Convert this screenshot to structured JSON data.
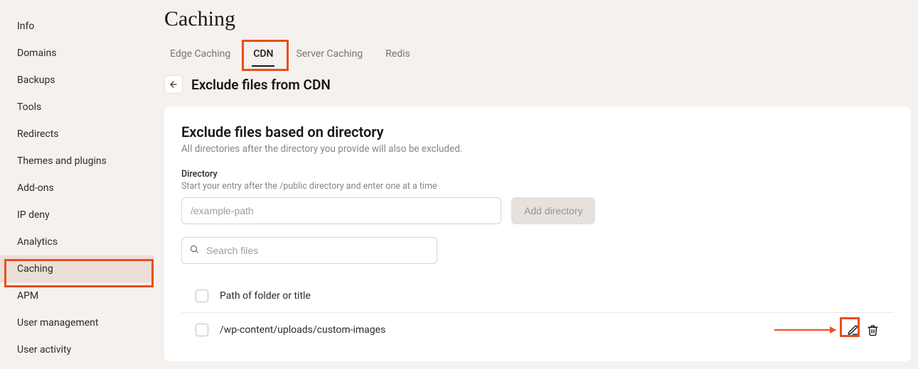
{
  "sidebar": {
    "items": [
      {
        "label": "Info"
      },
      {
        "label": "Domains"
      },
      {
        "label": "Backups"
      },
      {
        "label": "Tools"
      },
      {
        "label": "Redirects"
      },
      {
        "label": "Themes and plugins"
      },
      {
        "label": "Add-ons"
      },
      {
        "label": "IP deny"
      },
      {
        "label": "Analytics"
      },
      {
        "label": "Caching",
        "active": true
      },
      {
        "label": "APM"
      },
      {
        "label": "User management"
      },
      {
        "label": "User activity"
      }
    ]
  },
  "page": {
    "title": "Caching"
  },
  "tabs": [
    {
      "label": "Edge Caching"
    },
    {
      "label": "CDN",
      "active": true
    },
    {
      "label": "Server Caching"
    },
    {
      "label": "Redis"
    }
  ],
  "subhead": {
    "title": "Exclude files from CDN"
  },
  "card": {
    "heading": "Exclude files based on directory",
    "desc": "All directories after the directory you provide will also be excluded.",
    "dir_label": "Directory",
    "dir_hint": "Start your entry after the /public directory and enter one at a time",
    "dir_placeholder": "/example-path",
    "add_button": "Add directory",
    "search_placeholder": "Search files",
    "list_header": "Path of folder or title",
    "rows": [
      {
        "path": "/wp-content/uploads/custom-images"
      }
    ]
  }
}
